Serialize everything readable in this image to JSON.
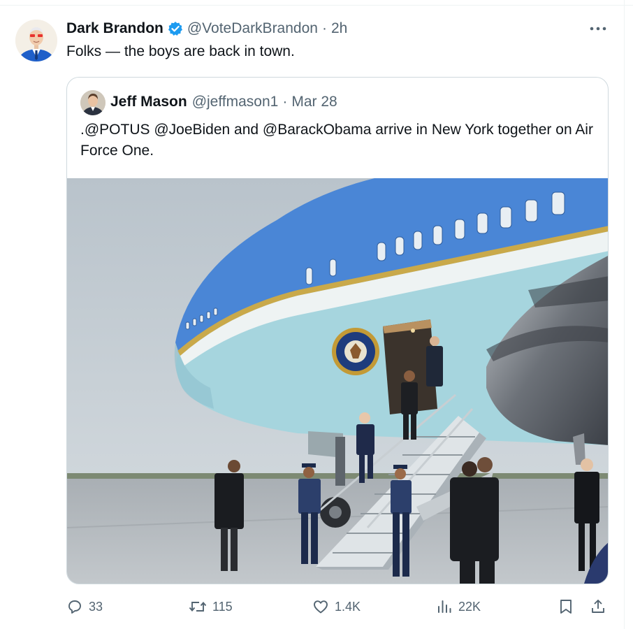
{
  "tweet": {
    "author_name": "Dark Brandon",
    "author_handle": "@VoteDarkBrandon",
    "separator": "·",
    "time": "2h",
    "text": "Folks — the boys are back in town.",
    "more_icon": "more-horizontal-icon"
  },
  "quoted_tweet": {
    "author_name": "Jeff Mason",
    "author_handle": "@jeffmason1",
    "separator": "·",
    "date": "Mar 28",
    "text": ".@POTUS @JoeBiden and @BarackObama arrive in New York together on Air Force One."
  },
  "actions": {
    "replies": "33",
    "reposts": "115",
    "likes": "1.4K",
    "views": "22K"
  },
  "colors": {
    "verified": "#1d9bf0",
    "secondary_text": "#536471",
    "border": "#cfd9de",
    "aircraft_blue": "#4a86d6",
    "aircraft_light": "#a6d5de",
    "cheatline_gold": "#c9a94a"
  }
}
